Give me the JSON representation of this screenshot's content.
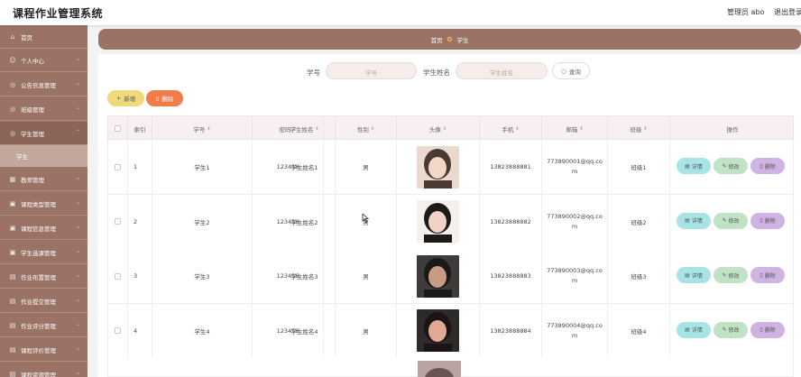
{
  "header": {
    "title": "课程作业管理系统",
    "admin_label": "管理员 abo",
    "logout_label": "退出登录"
  },
  "sidebar": {
    "items": [
      {
        "label": "首页",
        "icon": "home-icon"
      },
      {
        "label": "个人中心",
        "icon": "user-icon"
      },
      {
        "label": "公告信息管理",
        "icon": "notice-icon"
      },
      {
        "label": "班级管理",
        "icon": "class-icon"
      },
      {
        "label": "学生管理",
        "icon": "student-icon"
      },
      {
        "label": "教师管理",
        "icon": "teacher-icon"
      },
      {
        "label": "课程类型管理",
        "icon": "type-icon"
      },
      {
        "label": "课程信息管理",
        "icon": "course-icon"
      },
      {
        "label": "学生选课管理",
        "icon": "select-icon"
      },
      {
        "label": "作业布置管理",
        "icon": "assign-icon"
      },
      {
        "label": "作业提交管理",
        "icon": "submit-icon"
      },
      {
        "label": "作业评分管理",
        "icon": "score-icon"
      },
      {
        "label": "课程评价管理",
        "icon": "review-icon"
      },
      {
        "label": "课程资源管理",
        "icon": "resource-icon"
      }
    ],
    "sub_item": "学生"
  },
  "breadcrumb": {
    "home": "首页",
    "current": "学生"
  },
  "search": {
    "student_no_label": "学号",
    "student_no_placeholder": "学号",
    "student_name_label": "学生姓名",
    "student_name_placeholder": "学生姓名",
    "query_label": "查询"
  },
  "actions": {
    "add_label": "新增",
    "delete_label": "删除"
  },
  "table": {
    "headers": [
      "索引",
      "学号",
      "密码",
      "学生姓名",
      "性别",
      "头像",
      "手机",
      "邮箱",
      "班级",
      "操作"
    ],
    "rows": [
      {
        "index": "1",
        "no": "学生1",
        "password": "123456",
        "name": "学生姓名1",
        "gender": "男",
        "phone": "13823888881",
        "email": "773890001@qq.com",
        "class": "班级1"
      },
      {
        "index": "2",
        "no": "学生2",
        "password": "123456",
        "name": "学生姓名2",
        "gender": "男",
        "phone": "13823888882",
        "email": "773890002@qq.com",
        "class": "班级2"
      },
      {
        "index": "3",
        "no": "学生3",
        "password": "123456",
        "name": "学生姓名3",
        "gender": "男",
        "phone": "13823888883",
        "email": "773890003@qq.com",
        "class": "班级3"
      },
      {
        "index": "4",
        "no": "学生4",
        "password": "123456",
        "name": "学生姓名4",
        "gender": "男",
        "phone": "13823888884",
        "email": "773890004@qq.com",
        "class": "班级4"
      }
    ],
    "op_detail": "详情",
    "op_edit": "修改",
    "op_delete": "删除"
  },
  "colors": {
    "accent": "#9a7366",
    "add": "#f0d97a",
    "delete": "#f07c4c",
    "detail": "#a8e4e6",
    "edit": "#bfe3c4",
    "remove": "#cfb3e2"
  }
}
